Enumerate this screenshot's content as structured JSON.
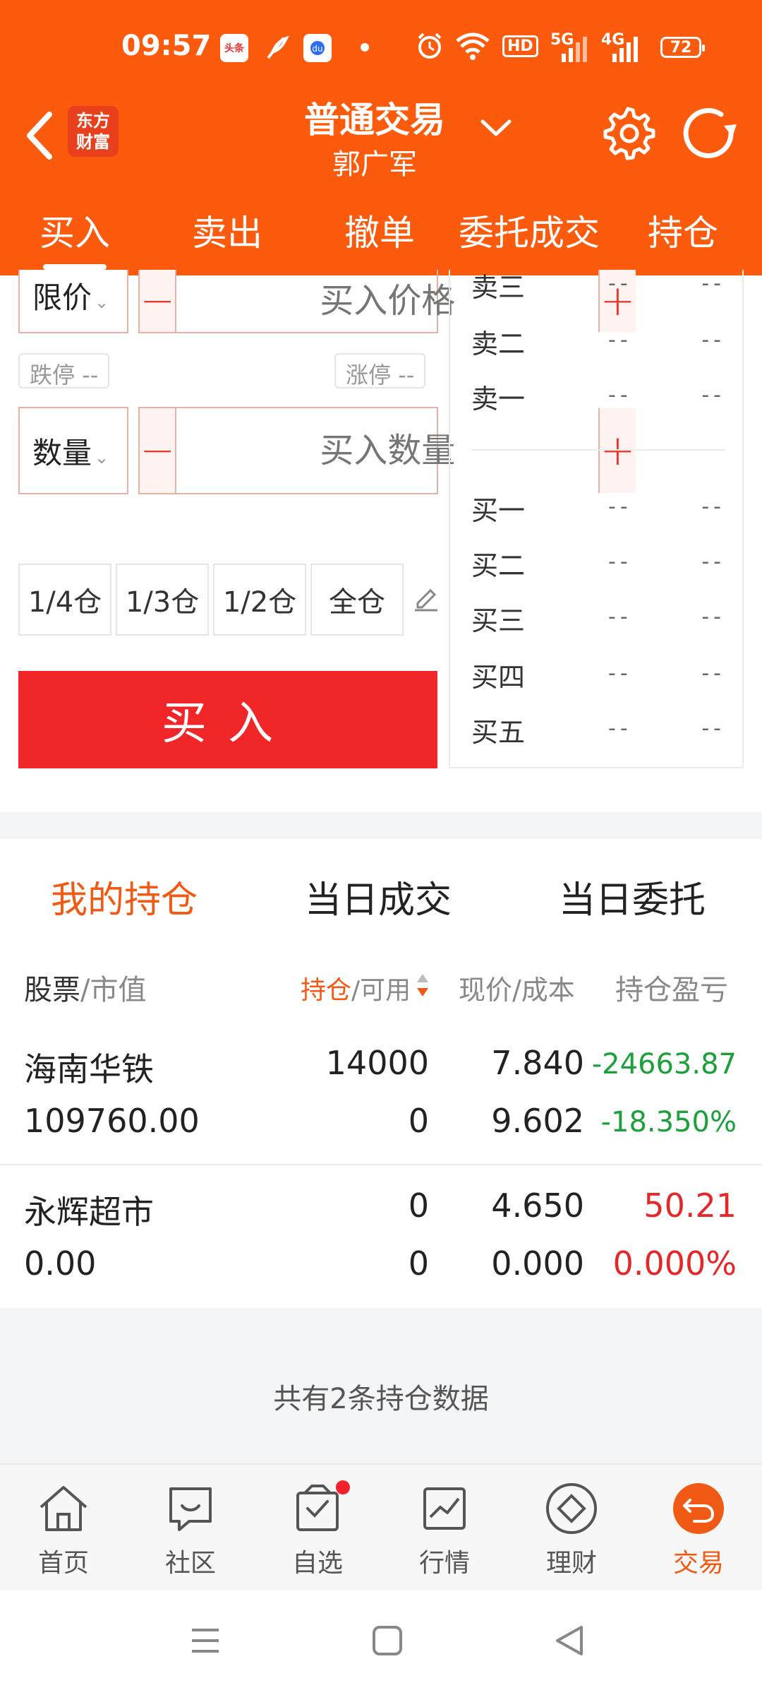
{
  "status_bar": {
    "time": "09:57",
    "app_badges": [
      "头条"
    ],
    "net": "HD",
    "net_5g": "5G",
    "net_4g": "4G",
    "battery": "72"
  },
  "header": {
    "logo_line1": "东方",
    "logo_line2": "财富",
    "title": "普通交易",
    "account_name": "郭广军"
  },
  "tabs": [
    {
      "label": "买入"
    },
    {
      "label": "卖出"
    },
    {
      "label": "撤单"
    },
    {
      "label": "委托成交"
    },
    {
      "label": "持仓"
    }
  ],
  "order": {
    "price_type": "限价",
    "price_placeholder": "买入价格",
    "limit_down": "跌停 --",
    "limit_up": "涨停 --",
    "qty_type": "数量",
    "qty_placeholder": "买入数量",
    "positions": [
      "1/4仓",
      "1/3仓",
      "1/2仓",
      "全仓"
    ],
    "buy_label": "买入"
  },
  "quotes": {
    "sell": [
      {
        "label": "卖三",
        "price": "--",
        "vol": "--"
      },
      {
        "label": "卖二",
        "price": "--",
        "vol": "--"
      },
      {
        "label": "卖一",
        "price": "--",
        "vol": "--"
      }
    ],
    "buy": [
      {
        "label": "买一",
        "price": "--",
        "vol": "--"
      },
      {
        "label": "买二",
        "price": "--",
        "vol": "--"
      },
      {
        "label": "买三",
        "price": "--",
        "vol": "--"
      },
      {
        "label": "买四",
        "price": "--",
        "vol": "--"
      },
      {
        "label": "买五",
        "price": "--",
        "vol": "--"
      }
    ]
  },
  "holdings": {
    "tabs": [
      "我的持仓",
      "当日成交",
      "当日委托"
    ],
    "columns": {
      "stock": "股票",
      "market_value": "/市值",
      "position": "持仓",
      "available": "/可用",
      "price_cost": "现价/成本",
      "pnl": "持仓盈亏"
    },
    "rows": [
      {
        "name": "海南华铁",
        "market_value": "109760.00",
        "position": "14000",
        "available": "0",
        "price": "7.840",
        "cost": "9.602",
        "pnl": "-24663.87",
        "pnl_pct": "-18.350%"
      },
      {
        "name": "永辉超市",
        "market_value": "0.00",
        "position": "0",
        "available": "0",
        "price": "4.650",
        "cost": "0.000",
        "pnl": "50.21",
        "pnl_pct": "0.000%"
      }
    ],
    "summary": "共有2条持仓数据"
  },
  "bottom_nav": [
    {
      "label": "首页",
      "icon": "home-icon"
    },
    {
      "label": "社区",
      "icon": "chat-icon"
    },
    {
      "label": "自选",
      "icon": "watchlist-icon"
    },
    {
      "label": "行情",
      "icon": "chart-icon"
    },
    {
      "label": "理财",
      "icon": "diamond-icon"
    },
    {
      "label": "交易",
      "icon": "trade-icon"
    }
  ],
  "colors": {
    "brand": "#fc5a0c",
    "buy_red": "#f12629",
    "loss_green": "#1d9f3c",
    "active_orange": "#f05a14"
  }
}
